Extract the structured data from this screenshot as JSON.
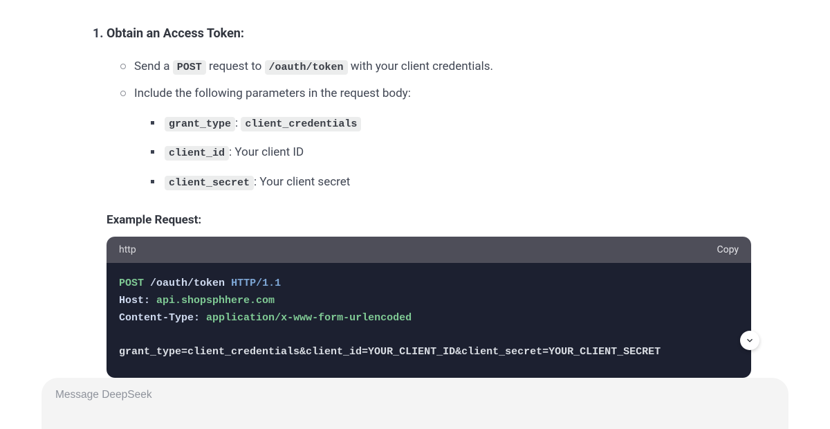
{
  "step": {
    "number": "1.",
    "title": "Obtain an Access Token:"
  },
  "bullet1": {
    "prefix": "Send a ",
    "method": "POST",
    "middle": " request to ",
    "endpoint": "/oauth/token",
    "suffix": " with your client credentials."
  },
  "bullet2": "Include the following parameters in the request body:",
  "params": {
    "grant_type": {
      "key": "grant_type",
      "sep": ": ",
      "val": "client_credentials"
    },
    "client_id": {
      "key": "client_id",
      "sep": ": ",
      "label": "Your client ID"
    },
    "client_secret": {
      "key": "client_secret",
      "sep": ": ",
      "label": "Your client secret"
    }
  },
  "example_heading": "Example Request:",
  "codeblock": {
    "language": "http",
    "copy_label": "Copy",
    "line1": {
      "method": "POST",
      "sp1": " ",
      "path": "/oauth/token",
      "sp2": " ",
      "proto": "HTTP/1.1"
    },
    "line2": {
      "name": "Host",
      "colon": ": ",
      "value": "api.shopsphhere.com"
    },
    "line3": {
      "name": "Content-Type",
      "colon": ": ",
      "value": "application/x-www-form-urlencoded"
    },
    "blank": " ",
    "body": "grant_type=client_credentials&client_id=YOUR_CLIENT_ID&client_secret=YOUR_CLIENT_SECRET"
  },
  "composer": {
    "placeholder": "Message DeepSeek"
  }
}
